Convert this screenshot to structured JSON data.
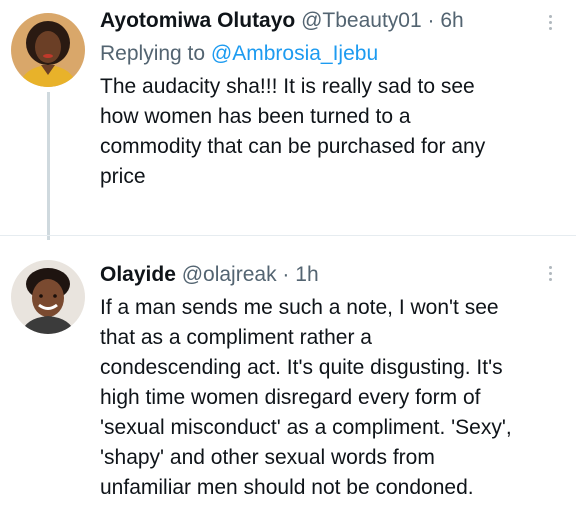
{
  "tweets": [
    {
      "display_name": "Ayotomiwa Olutayo",
      "handle": "@Tbeauty01",
      "separator": "·",
      "time": "6h",
      "replying_label": "Replying to",
      "replying_to": "@Ambrosia_Ijebu",
      "text_lines": [
        "The audacity sha!!! It is really sad to see",
        "how women has been turned to a",
        "commodity that can be purchased for any",
        "price"
      ]
    },
    {
      "display_name": "Olayide",
      "handle": "@olajreak",
      "separator": "·",
      "time": "1h",
      "text_lines": [
        "If a man sends me such a note, I won't see",
        "that as a compliment rather a",
        "condescending act. It's quite disgusting. It's",
        "high time women disregard every form of",
        "'sexual misconduct' as a compliment. 'Sexy',",
        "'shapy' and other sexual words from",
        "unfamiliar men should not be condoned."
      ]
    }
  ],
  "icons": {
    "more": "more-options-icon",
    "avatar": "avatar"
  },
  "colors": {
    "link": "#1d9bf0",
    "secondary_text": "#536471",
    "primary_text": "#0f1419",
    "thread_line": "#cfd9de"
  }
}
